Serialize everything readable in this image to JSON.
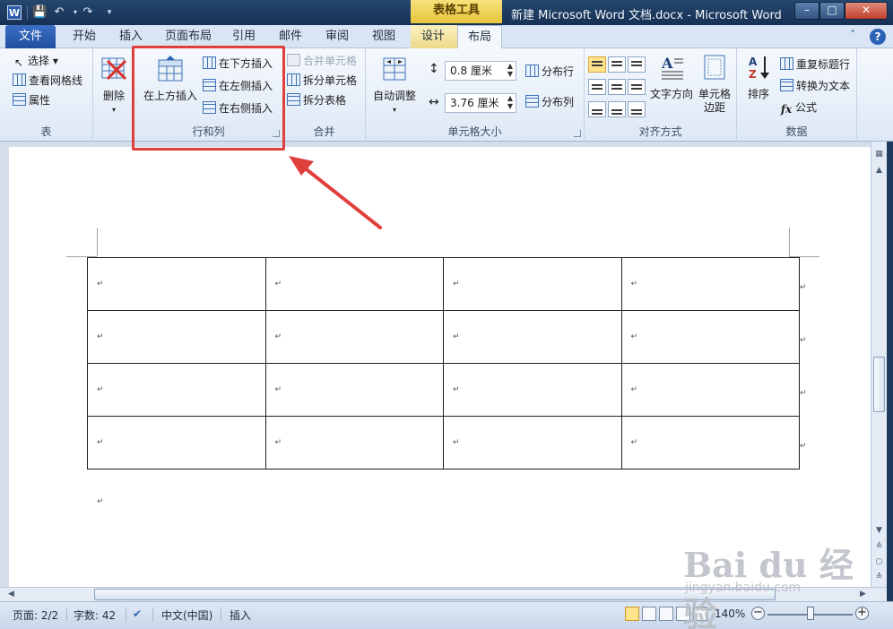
{
  "window": {
    "title": "新建 Microsoft Word 文档.docx  -  Microsoft Word",
    "context_tab": "表格工具",
    "app_icon_letter": "W"
  },
  "tabs": [
    "文件",
    "开始",
    "插入",
    "页面布局",
    "引用",
    "邮件",
    "审阅",
    "视图",
    "设计",
    "布局"
  ],
  "active_tab": "布局",
  "ribbon": {
    "table_group": {
      "label": "表",
      "items": [
        "选择 ▾",
        "查看网格线",
        "属性"
      ]
    },
    "delete_group": {
      "label": "删除"
    },
    "rowcol_group": {
      "label": "行和列",
      "insert_above": "在上方插入",
      "insert_below": "在下方插入",
      "insert_left": "在左侧插入",
      "insert_right": "在右侧插入"
    },
    "merge_group": {
      "label": "合并",
      "items": [
        "合并单元格",
        "拆分单元格",
        "拆分表格"
      ]
    },
    "size_group": {
      "label": "单元格大小",
      "autofit": "自动调整",
      "height": "0.8 厘米",
      "width": "3.76 厘米",
      "distribute_rows": "分布行",
      "distribute_cols": "分布列"
    },
    "align_group": {
      "label": "对齐方式",
      "text_direction": "文字方向",
      "cell_margins_line1": "单元格",
      "cell_margins_line2": "边距"
    },
    "data_group": {
      "label": "数据",
      "sort": "排序",
      "repeat_header": "重复标题行",
      "convert_to_text": "转换为文本",
      "formula": "公式"
    }
  },
  "document": {
    "table_rows": 4,
    "table_cols": 4,
    "paragraph_mark": "↵"
  },
  "statusbar": {
    "page": "页面: 2/2",
    "words": "字数: 42",
    "language": "中文(中国)",
    "mode": "插入",
    "zoom": "140%",
    "zoom_level": 0.5
  },
  "watermark": {
    "big": "Bai du 经验",
    "small": "jingyan.baidu.com"
  },
  "colors": {
    "highlight": "#e0403c",
    "context_tab": "#e6c53a",
    "file_tab": "#2b5aa8"
  }
}
